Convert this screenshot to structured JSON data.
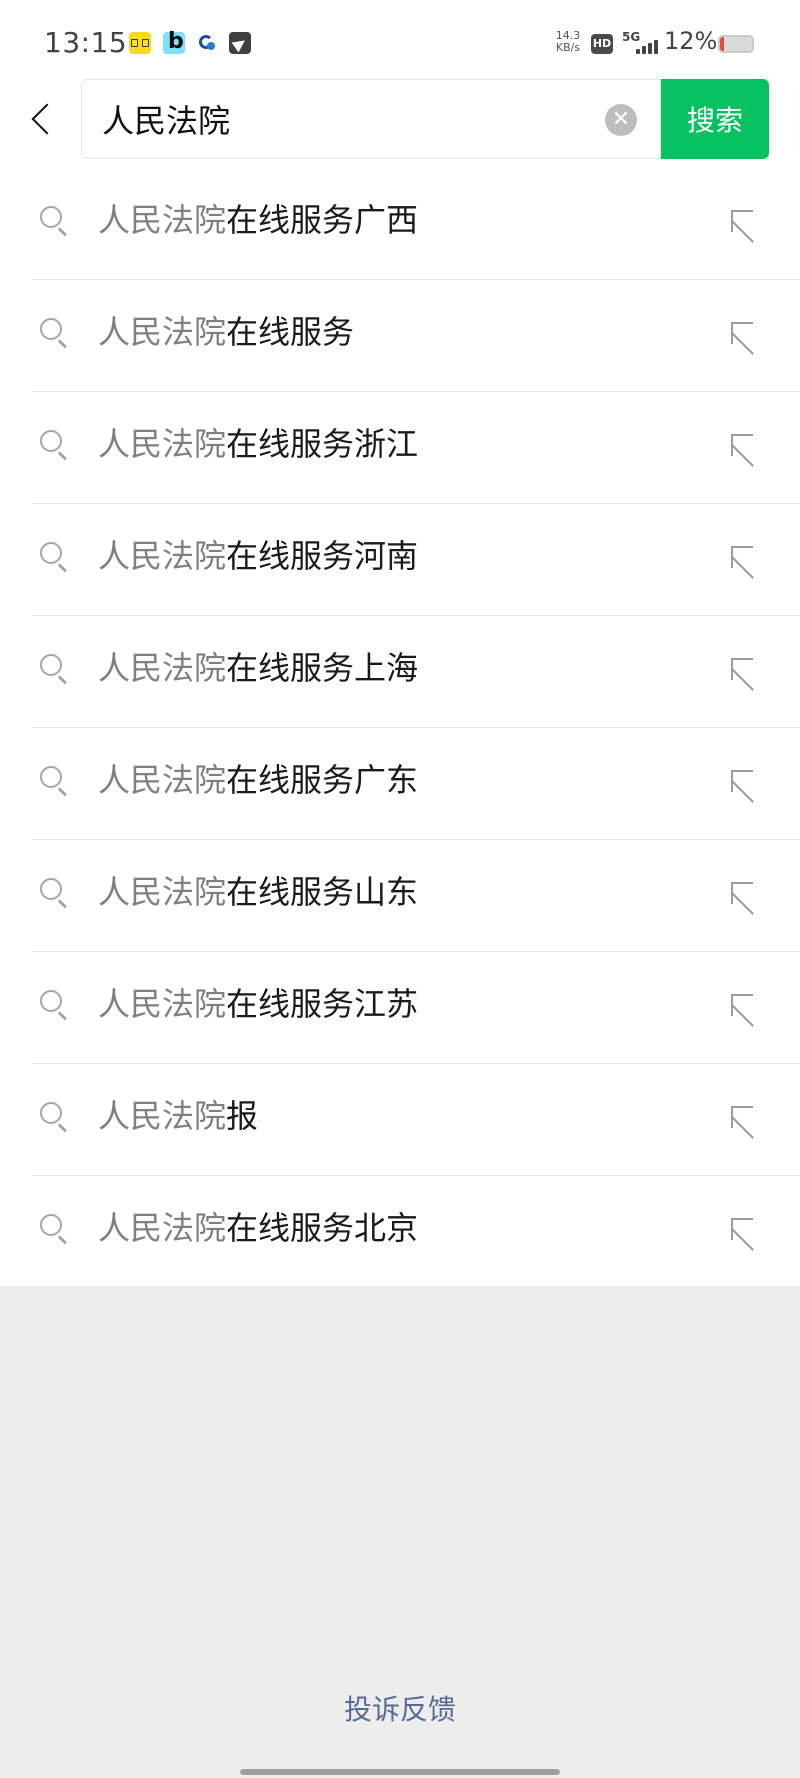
{
  "status_bar": {
    "time": "13:15",
    "net_speed_value": "14.3",
    "net_speed_unit": "KB/s",
    "hd": "HD",
    "network": "5G",
    "battery_percent": "12%",
    "battery_level": 0.12,
    "app_icons": [
      "yellow-app-icon",
      "b-app-icon",
      "blue-swirl-app-icon",
      "telegram-icon"
    ]
  },
  "search": {
    "query": "人民法院",
    "button_label": "搜索"
  },
  "suggestions": [
    {
      "match": "人民法院",
      "rest": "在线服务广西"
    },
    {
      "match": "人民法院",
      "rest": "在线服务"
    },
    {
      "match": "人民法院",
      "rest": "在线服务浙江"
    },
    {
      "match": "人民法院",
      "rest": "在线服务河南"
    },
    {
      "match": "人民法院",
      "rest": "在线服务上海"
    },
    {
      "match": "人民法院",
      "rest": "在线服务广东"
    },
    {
      "match": "人民法院",
      "rest": "在线服务山东"
    },
    {
      "match": "人民法院",
      "rest": "在线服务江苏"
    },
    {
      "match": "人民法院",
      "rest": "报"
    },
    {
      "match": "人民法院",
      "rest": "在线服务北京"
    }
  ],
  "footer": {
    "feedback_label": "投诉反馈"
  },
  "colors": {
    "accent": "#07c160",
    "link": "#576b95",
    "battery_low": "#e64a3b"
  }
}
